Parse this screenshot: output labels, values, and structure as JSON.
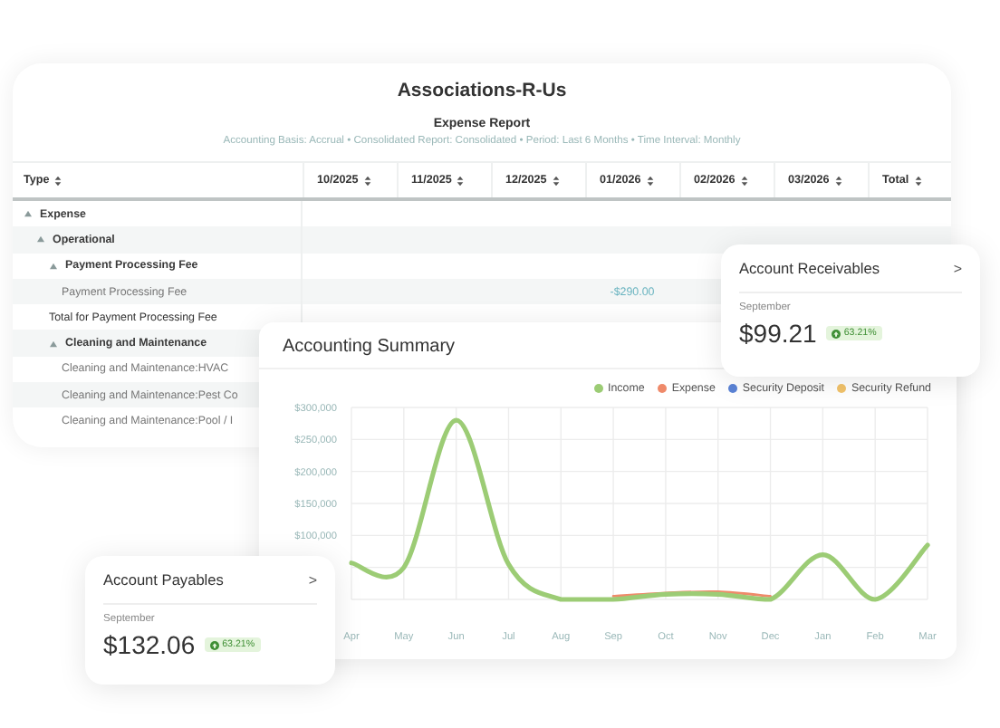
{
  "report": {
    "title": "Associations-R-Us",
    "subtitle": "Expense Report",
    "meta": "Accounting Basis: Accrual • Consolidated Report: Consolidated • Period: Last 6 Months • Time Interval: Monthly",
    "columns": [
      "Type",
      "10/2025",
      "11/2025",
      "12/2025",
      "01/2026",
      "02/2026",
      "03/2026",
      "Total"
    ],
    "rows": [
      {
        "label": "Expense",
        "kind": "group",
        "expanded": true,
        "children": [
          {
            "label": "Operational",
            "kind": "group",
            "expanded": true,
            "children": [
              {
                "label": "Payment Processing Fee",
                "kind": "group",
                "expanded": true,
                "children": [
                  {
                    "label": "Payment Processing Fee",
                    "kind": "item",
                    "values": {
                      "column_5": "-$290.00"
                    }
                  }
                ]
              },
              {
                "label": "Total for Payment Processing Fee",
                "kind": "total"
              },
              {
                "label": "Cleaning and Maintenance",
                "kind": "group",
                "expanded": true,
                "children": [
                  {
                    "label": "Cleaning and Maintenance:HVAC",
                    "kind": "item"
                  },
                  {
                    "label": "Cleaning and Maintenance:Pest Co",
                    "kind": "item"
                  },
                  {
                    "label": "Cleaning and Maintenance:Pool / I",
                    "kind": "item"
                  }
                ]
              }
            ]
          }
        ]
      }
    ]
  },
  "summary": {
    "title": "Accounting Summary",
    "chart_data": {
      "type": "line",
      "categories": [
        "Apr",
        "May",
        "Jun",
        "Jul",
        "Aug",
        "Sep",
        "Oct",
        "Nov",
        "Dec",
        "Jan",
        "Feb",
        "Mar"
      ],
      "ylim": [
        0,
        300000
      ],
      "yticks": [
        {
          "value": 100000,
          "label": "$100,000"
        },
        {
          "value": 150000,
          "label": "$150,000"
        },
        {
          "value": 200000,
          "label": "$200,000"
        },
        {
          "value": 250000,
          "label": "$250,000"
        },
        {
          "value": 300000,
          "label": "$300,000"
        }
      ],
      "grid": true,
      "series": [
        {
          "name": "Income",
          "color": "#9ccc75",
          "values": [
            57000,
            50000,
            280000,
            55000,
            0,
            0,
            8000,
            8000,
            0,
            70000,
            0,
            85000
          ]
        },
        {
          "name": "Expense",
          "color": "#ef8a6a",
          "values": [
            null,
            null,
            null,
            null,
            null,
            5000,
            10000,
            12000,
            5000,
            null,
            null,
            null
          ]
        },
        {
          "name": "Security Deposit",
          "color": "#5b83d6",
          "values": [
            null,
            null,
            null,
            null,
            null,
            null,
            null,
            null,
            null,
            null,
            null,
            null
          ]
        },
        {
          "name": "Security Refund",
          "color": "#f2c36b",
          "values": [
            null,
            null,
            null,
            null,
            null,
            null,
            null,
            null,
            null,
            null,
            null,
            null
          ]
        }
      ]
    }
  },
  "cards": [
    {
      "title": "Account Receivables",
      "chevron": ">",
      "period": "September",
      "amount": "$99.21",
      "change": "63.21%"
    },
    {
      "title": "Account Payables",
      "chevron": ">",
      "period": "September",
      "amount": "$132.06",
      "change": "63.21%"
    }
  ]
}
